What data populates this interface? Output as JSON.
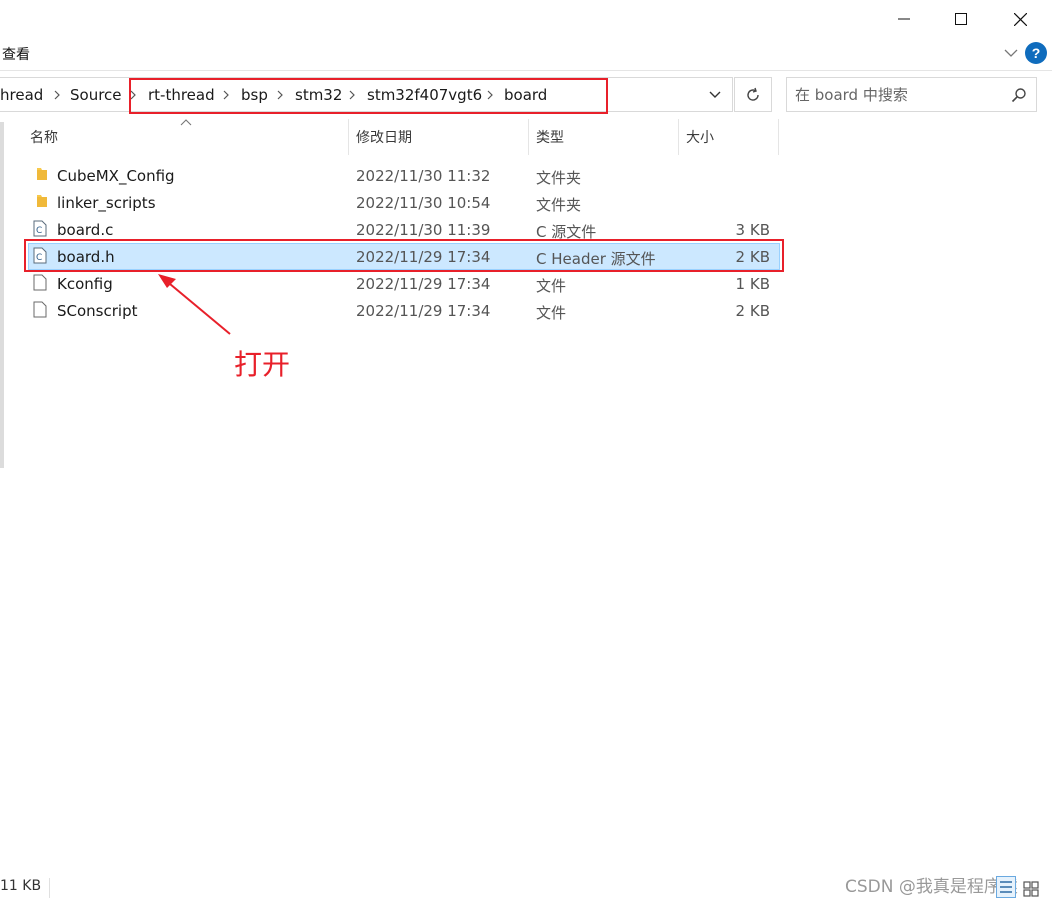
{
  "window": {
    "minimize_label": "minimize",
    "maximize_label": "maximize",
    "close_label": "close"
  },
  "ribbon": {
    "view_tab": "查看",
    "help_label": "?"
  },
  "address": {
    "crumbs": [
      "hread",
      "Source",
      "rt-thread",
      "bsp",
      "stm32",
      "stm32f407vgt6",
      "board"
    ]
  },
  "search": {
    "placeholder": "在 board 中搜索"
  },
  "columns": {
    "name": "名称",
    "modified": "修改日期",
    "type": "类型",
    "size": "大小"
  },
  "files": [
    {
      "name": "CubeMX_Config",
      "modified": "2022/11/30 11:32",
      "type": "文件夹",
      "size": "",
      "icon": "folder-icon"
    },
    {
      "name": "linker_scripts",
      "modified": "2022/11/30 10:54",
      "type": "文件夹",
      "size": "",
      "icon": "folder-icon"
    },
    {
      "name": "board.c",
      "modified": "2022/11/30 11:39",
      "type": "C 源文件",
      "size": "3 KB",
      "icon": "c-file-icon"
    },
    {
      "name": "board.h",
      "modified": "2022/11/29 17:34",
      "type": "C Header 源文件",
      "size": "2 KB",
      "icon": "c-file-icon"
    },
    {
      "name": "Kconfig",
      "modified": "2022/11/29 17:34",
      "type": "文件",
      "size": "1 KB",
      "icon": "file-icon"
    },
    {
      "name": "SConscript",
      "modified": "2022/11/29 17:34",
      "type": "文件",
      "size": "2 KB",
      "icon": "file-icon"
    }
  ],
  "annotation": {
    "text": "打开",
    "color": "#e8202a"
  },
  "status": {
    "item_size": "11 KB"
  },
  "watermark": "CSDN @我真是程序猿",
  "colors": {
    "selection_bg": "#cce8ff",
    "selection_border": "#99d1ff",
    "folder": "#f8c94a",
    "help_blue": "#0f6cbd"
  }
}
